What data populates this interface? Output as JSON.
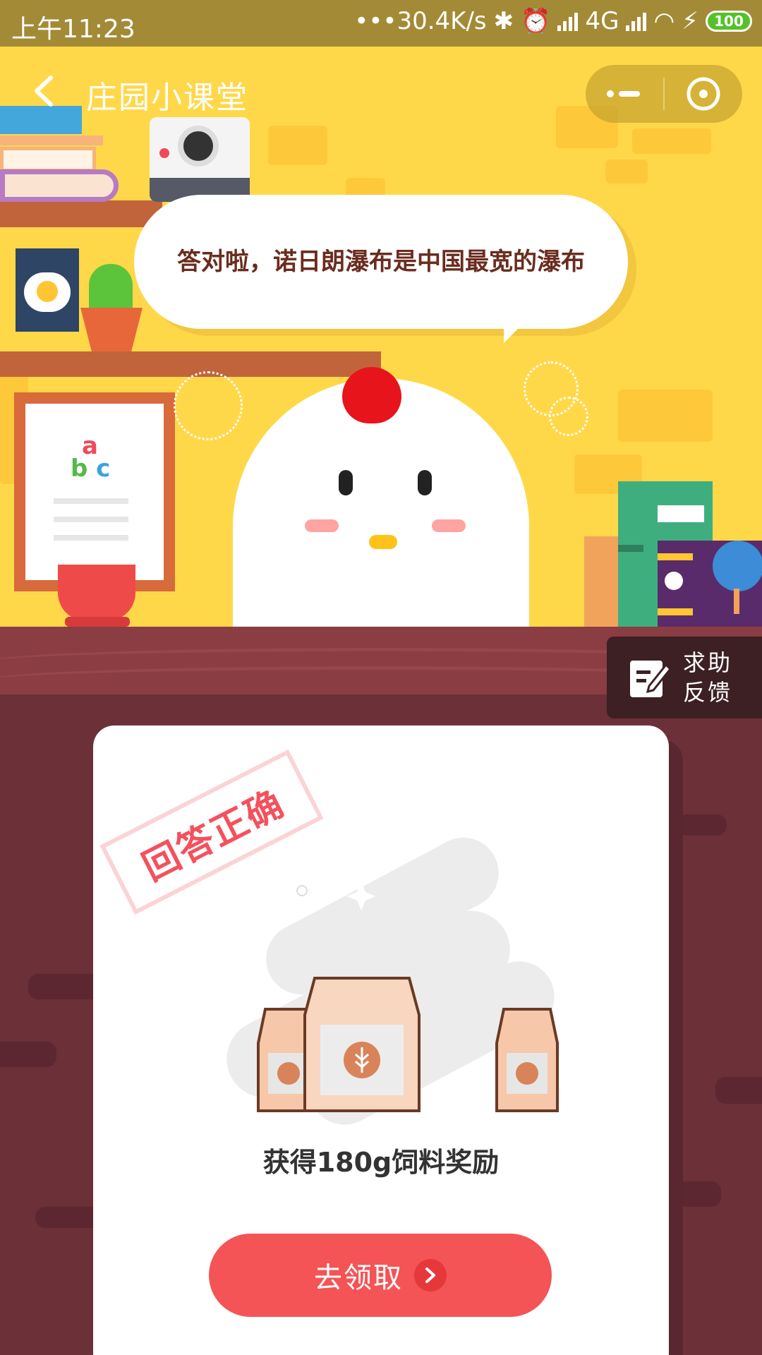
{
  "status_bar": {
    "time": "上午11:23",
    "speed": "•••30.4K/s",
    "network": "4G",
    "battery": "100"
  },
  "nav": {
    "title": "庄园小课堂",
    "back_icon": "chevron-left-icon",
    "more_icon": "more-icon",
    "close_icon": "close-icon"
  },
  "bubble": {
    "text": "答对啦，诺日朗瀑布是中国最宽的瀑布"
  },
  "help": {
    "label_line1": "求助",
    "label_line2": "反馈"
  },
  "card": {
    "stamp": "回答正确",
    "reward_text": "获得180g饲料奖励",
    "button_label": "去领取"
  },
  "colors": {
    "accent": "#f45456",
    "scene_bg": "#ffd84a",
    "table": "#6b3038"
  }
}
